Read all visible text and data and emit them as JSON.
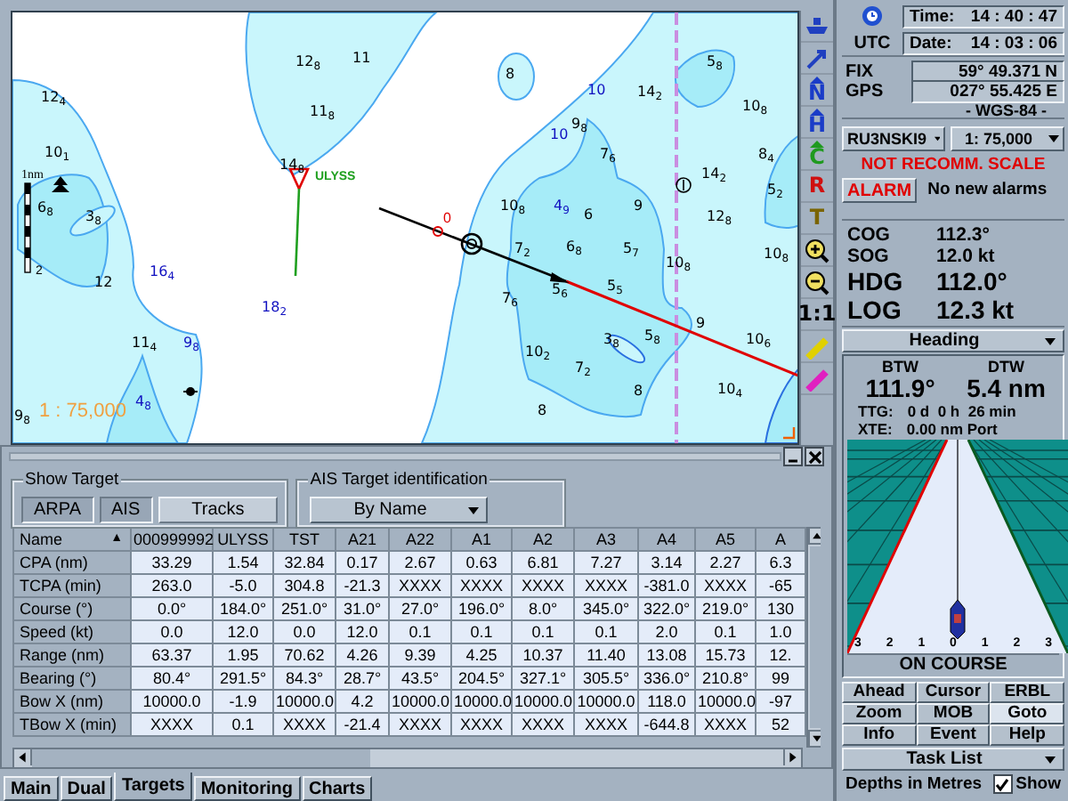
{
  "map": {
    "scale_bar_label": "1nm",
    "scale_bar_mark": "2",
    "target_label": "ULYSS",
    "waypoint_label": "0",
    "scale_text": "1 : 75,000",
    "soundings": [
      {
        "text": "12$_{4}$",
        "color": "#000000"
      },
      {
        "text": "10$_{1}$",
        "color": "#000000"
      },
      {
        "text": "6$_{8}$",
        "color": "#000000"
      },
      {
        "text": "3$_{8}$",
        "color": "#000000"
      },
      {
        "text": "12",
        "color": "#000000"
      },
      {
        "text": "16$_{4}$",
        "color": "#1010c0"
      },
      {
        "text": "18$_{2}$",
        "color": "#1010c0"
      },
      {
        "text": "11$_{4}$",
        "color": "#000000"
      },
      {
        "text": "9$_{8}$",
        "color": "#1010c0"
      },
      {
        "text": "4$_{8}$",
        "color": "#1010c0"
      },
      {
        "text": "9$_{8}$",
        "color": "#000000"
      },
      {
        "text": "12$_{8}$",
        "color": "#000000"
      },
      {
        "text": "11",
        "color": "#000000"
      },
      {
        "text": "11$_{8}$",
        "color": "#000000"
      },
      {
        "text": "14$_{8}$",
        "color": "#000000"
      },
      {
        "text": "8",
        "color": "#000000"
      },
      {
        "text": "10",
        "color": "#1010c0"
      },
      {
        "text": "14$_{2}$",
        "color": "#000000"
      },
      {
        "text": "5$_{8}$",
        "color": "#000000"
      },
      {
        "text": "10$_{8}$",
        "color": "#000000"
      },
      {
        "text": "10",
        "color": "#1010c0"
      },
      {
        "text": "9$_{8}$",
        "color": "#000000"
      },
      {
        "text": "7$_{6}$",
        "color": "#000000"
      },
      {
        "text": "8$_{4}$",
        "color": "#000000"
      },
      {
        "text": "14$_{2}$",
        "color": "#000000"
      },
      {
        "text": "5$_{2}$",
        "color": "#000000"
      },
      {
        "text": "10$_{8}$",
        "color": "#000000"
      },
      {
        "text": "4$_{9}$",
        "color": "#1010c0"
      },
      {
        "text": "6",
        "color": "#000000"
      },
      {
        "text": "9",
        "color": "#000000"
      },
      {
        "text": "12$_{8}$",
        "color": "#000000"
      },
      {
        "text": "7$_{2}$",
        "color": "#000000"
      },
      {
        "text": "6$_{8}$",
        "color": "#000000"
      },
      {
        "text": "5$_{7}$",
        "color": "#000000"
      },
      {
        "text": "10$_{8}$",
        "color": "#000000"
      },
      {
        "text": "10$_{8}$",
        "color": "#000000"
      },
      {
        "text": "7$_{6}$",
        "color": "#000000"
      },
      {
        "text": "5$_{6}$",
        "color": "#000000"
      },
      {
        "text": "5$_{5}$",
        "color": "#000000"
      },
      {
        "text": "3$_{8}$",
        "color": "#000000"
      },
      {
        "text": "5$_{8}$",
        "color": "#000000"
      },
      {
        "text": "9",
        "color": "#000000"
      },
      {
        "text": "10$_{6}$",
        "color": "#000000"
      },
      {
        "text": "10$_{2}$",
        "color": "#000000"
      },
      {
        "text": "7$_{2}$",
        "color": "#000000"
      },
      {
        "text": "8",
        "color": "#000000"
      },
      {
        "text": "10$_{4}$",
        "color": "#000000"
      },
      {
        "text": "8",
        "color": "#000000"
      }
    ]
  },
  "toolbar": [
    {
      "kind": "ship"
    },
    {
      "kind": "pen-arrow"
    },
    {
      "kind": "letter-arrow",
      "label": "N",
      "color": "#1a3cc8"
    },
    {
      "kind": "letter-arrow",
      "label": "H",
      "color": "#1a3cc8"
    },
    {
      "kind": "letter-arrow",
      "label": "C",
      "color": "#1f9a1f"
    },
    {
      "kind": "letter",
      "label": "R",
      "color": "#d01010"
    },
    {
      "kind": "letter",
      "label": "T",
      "color": "#7a6400"
    },
    {
      "kind": "zoom-in"
    },
    {
      "kind": "zoom-out"
    },
    {
      "kind": "letter",
      "label": "1:1",
      "color": "#000000"
    },
    {
      "kind": "pencil",
      "color": "#e0d000"
    },
    {
      "kind": "pencil",
      "color": "#e020c0"
    }
  ],
  "show_target": {
    "title": "Show Target",
    "buttons": [
      {
        "label": "ARPA",
        "selected": true
      },
      {
        "label": "AIS",
        "selected": true
      },
      {
        "label": "Tracks",
        "selected": false
      }
    ]
  },
  "ais_identification": {
    "title": "AIS Target identification",
    "value": "By Name"
  },
  "table": {
    "columns": [
      "Name",
      "000999992",
      "ULYSS",
      "TST",
      "A21",
      "A22",
      "A1",
      "A2",
      "A3",
      "A4",
      "A5",
      "A"
    ],
    "sort_mark": "▲",
    "rows": [
      [
        "CPA (nm)",
        "33.29",
        "1.54",
        "32.84",
        "0.17",
        "2.67",
        "0.63",
        "6.81",
        "7.27",
        "3.14",
        "2.27",
        "6.3"
      ],
      [
        "TCPA (min)",
        "263.0",
        "-5.0",
        "304.8",
        "-21.3",
        "XXXX",
        "XXXX",
        "XXXX",
        "XXXX",
        "-381.0",
        "XXXX",
        "-65"
      ],
      [
        "Course (°)",
        "0.0°",
        "184.0°",
        "251.0°",
        "31.0°",
        "27.0°",
        "196.0°",
        "8.0°",
        "345.0°",
        "322.0°",
        "219.0°",
        "130"
      ],
      [
        "Speed (kt)",
        "0.0",
        "12.0",
        "0.0",
        "12.0",
        "0.1",
        "0.1",
        "0.1",
        "0.1",
        "2.0",
        "0.1",
        "1.0"
      ],
      [
        "Range (nm)",
        "63.37",
        "1.95",
        "70.62",
        "4.26",
        "9.39",
        "4.25",
        "10.37",
        "11.40",
        "13.08",
        "15.73",
        "12."
      ],
      [
        "Bearing (°)",
        "80.4°",
        "291.5°",
        "84.3°",
        "28.7°",
        "43.5°",
        "204.5°",
        "327.1°",
        "305.5°",
        "336.0°",
        "210.8°",
        "99"
      ],
      [
        "Bow X (nm)",
        "10000.0",
        "-1.9",
        "10000.0",
        "4.2",
        "10000.0",
        "10000.0",
        "10000.0",
        "10000.0",
        "118.0",
        "10000.0",
        "-97"
      ],
      [
        "TBow X (min)",
        "XXXX",
        "0.1",
        "XXXX",
        "-21.4",
        "XXXX",
        "XXXX",
        "XXXX",
        "XXXX",
        "-644.8",
        "XXXX",
        "52"
      ]
    ]
  },
  "tabs": [
    {
      "label": "Main",
      "selected": false
    },
    {
      "label": "Dual",
      "selected": false
    },
    {
      "label": "Targets",
      "selected": true
    },
    {
      "label": "Monitoring",
      "selected": false
    },
    {
      "label": "Charts",
      "selected": false
    }
  ],
  "status": {
    "utc_label": "UTC",
    "time_label": "Time:",
    "time": "14 : 40 : 47",
    "date_label": "Date:",
    "date": "14 : 03 : 06",
    "fix_label": "FIX",
    "gps_label": "GPS",
    "latitude": "59° 49.371 N",
    "longitude": "027° 55.425 E",
    "datum": "- WGS-84 -",
    "chart": "RU3NSKI9",
    "scale": "1: 75,000",
    "scale_warning": "NOT RECOMM. SCALE",
    "alarm_button": "ALARM",
    "alarm_text": "No new alarms",
    "nav": [
      {
        "label": "COG",
        "value": "112.3°",
        "kind": "small"
      },
      {
        "label": "SOG",
        "value": "12.0 kt",
        "kind": "small"
      },
      {
        "label": "HDG",
        "value": "112.0°",
        "kind": "large"
      },
      {
        "label": "LOG",
        "value": "12.3 kt",
        "kind": "large"
      }
    ],
    "mode": "Heading",
    "btw_label": "BTW",
    "dtw_label": "DTW",
    "btw": "111.9°",
    "dtw": "5.4 nm",
    "ttg_label": "TTG:",
    "ttg": "0 d  0 h  26 min",
    "xte_label": "XTE:",
    "xte": "0.00 nm Port",
    "highway_scale": [
      "3",
      "2",
      "1",
      "0",
      "1",
      "2",
      "3"
    ],
    "course_status": "ON COURSE",
    "buttons": [
      {
        "label": "Ahead",
        "selected": false
      },
      {
        "label": "Cursor",
        "selected": false
      },
      {
        "label": "ERBL",
        "selected": false
      },
      {
        "label": "Zoom",
        "selected": false
      },
      {
        "label": "MOB",
        "selected": false
      },
      {
        "label": "Goto",
        "selected": true
      },
      {
        "label": "Info",
        "selected": false
      },
      {
        "label": "Event",
        "selected": false
      },
      {
        "label": "Help",
        "selected": false
      }
    ],
    "task_list": "Task List",
    "depths_label": "Depths in Metres",
    "show_label": "Show",
    "show_checked": true
  }
}
